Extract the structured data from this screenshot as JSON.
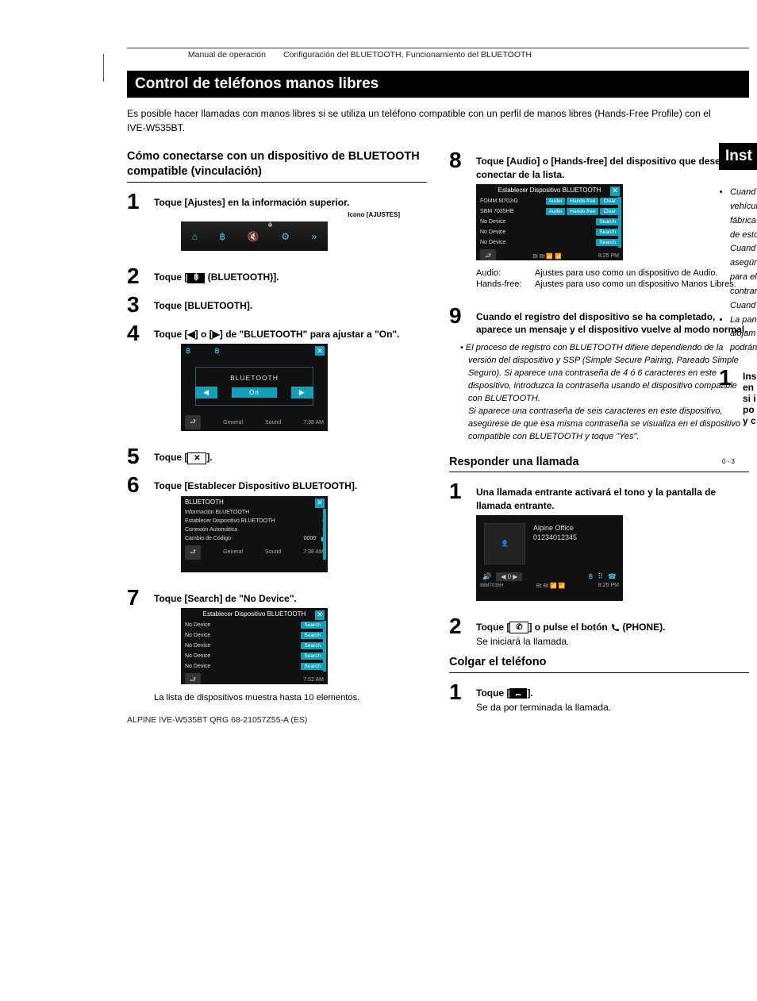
{
  "header": {
    "left": "Manual de operación",
    "right": "Configuración del BLUETOOTH, Funcionamiento del BLUETOOTH"
  },
  "banner": "Control de teléfonos manos libres",
  "intro": "Es posible hacer llamadas con manos libres si se utiliza un teléfono compatible con un perfil de manos libres (Hands-Free Profile) con el IVE-W535BT.",
  "section1_title": "Cómo conectarse con un dispositivo de BLUETOOTH compatible (vinculación)",
  "steps_left": {
    "s1": "Toque [Ajustes] en la información superior.",
    "s1_caption": "Icono [AJUSTES]",
    "s2_a": "Toque [",
    "s2_b": " (BLUETOOTH)].",
    "s3": "Toque [BLUETOOTH].",
    "s4": "Toque [◀] o [▶] de \"BLUETOOTH\" para ajustar a \"On\".",
    "s5_a": "Toque [",
    "s5_b": "].",
    "s6": "Toque [Establecer Dispositivo BLUETOOTH].",
    "s7": "Toque [Search] de \"No Device\".",
    "s7_note": "La lista de dispositivos muestra hasta 10 elementos."
  },
  "fig_bt_menu": {
    "title": "BLUETOOTH",
    "r1": "Información BLUETOOTH",
    "r2": "Establecer Dispositivo BLUETOOTH",
    "r3": "Conexión Automática",
    "r4": "Cambio de Código",
    "code": "0000",
    "f1": "General",
    "f2": "Sound",
    "time": "7:38 AM"
  },
  "fig_bt_on": {
    "label": "BLUETOOTH",
    "value": "On",
    "f1": "General",
    "f2": "Sound",
    "time": "7:38 AM"
  },
  "fig_search": {
    "title": "Establecer Dispositivo BLUETOOTH",
    "row": "No Device",
    "btn": "Search",
    "time": "7:52 AM"
  },
  "steps_right": {
    "s8": "Toque [Audio] o [Hands-free] del dispositivo que desee conectar de la lista.",
    "s9": "Cuando el registro del dispositivo se ha completado, aparece un mensaje y el dispositivo vuelve al modo normal."
  },
  "fig_list": {
    "title": "Establecer Dispositivo BLUETOOTH",
    "d1": "FOMM M702iG",
    "d2": "SBM 7035HB",
    "nd": "No Device",
    "a": "Audio",
    "h": "Hands-free",
    "c": "Clear",
    "s": "Search",
    "time": "8:25 PM"
  },
  "desc": {
    "k1": "Audio:",
    "v1": "Ajustes para uso como un dispositivo de Audio.",
    "k2": "Hands-free:",
    "v2": "Ajustes para uso como un dispositivo Manos Libres."
  },
  "note9": "El proceso de registro con BLUETOOTH difiere dependiendo de la versión del dispositivo y SSP (Simple Secure Pairing, Pareado Simple Seguro). Si aparece una contraseña de 4 ó 6 caracteres en este dispositivo, introduzca la contraseña usando el dispositivo compatible con BLUETOOTH.\nSi aparece una contraseña de seis caracteres en este dispositivo, asegúrese de que esa misma contraseña se visualiza en el dispositivo compatible con BLUETOOTH y toque \"Yes\".",
  "section2_title": "Responder una llamada",
  "answer": {
    "s1": "Una llamada entrante activará el tono y la pantalla de llamada entrante.",
    "s2_a": "Toque [",
    "s2_b": "] o pulse el botón ",
    "s2_c": " (PHONE).",
    "s2_sub": "Se iniciará la llamada."
  },
  "fig_call": {
    "name": "Alpine Office",
    "num": "01234012345",
    "vol": "0",
    "time": "8:25 PM"
  },
  "section3_title": "Colgar el teléfono",
  "hang": {
    "s1_a": "Toque [",
    "s1_b": "].",
    "s1_sub": "Se da por terminada la llamada."
  },
  "footer": "ALPINE IVE-W535BT QRG 68-21057Z55-A (ES)",
  "cut": {
    "banner": "Inst",
    "li": [
      "Cuand",
      "vehícul",
      "fábrica",
      "de esto",
      "Cuand",
      "asegúr",
      "para el",
      "contrar",
      "Cuand",
      "La pan",
      "alojam",
      "podrán"
    ],
    "step1": [
      "Ins",
      "en",
      "si i",
      "po",
      "y c"
    ],
    "scale": "0 - 3"
  }
}
